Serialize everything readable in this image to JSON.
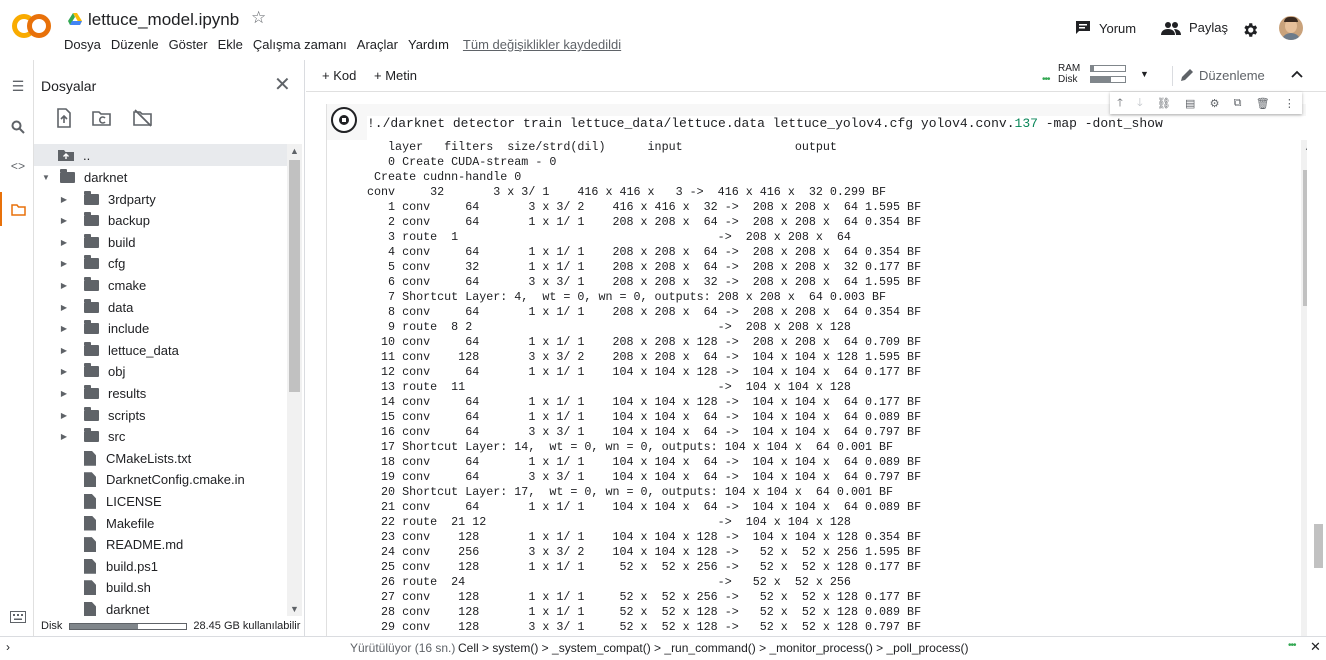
{
  "header": {
    "title": "lettuce_model.ipynb",
    "menu": [
      "Dosya",
      "Düzenle",
      "Göster",
      "Ekle",
      "Çalışma zamanı",
      "Araçlar",
      "Yardım"
    ],
    "saved_label": "Tüm değişiklikler kaydedildi",
    "comment_label": "Yorum",
    "share_label": "Paylaş",
    "logo_text": "CO"
  },
  "files": {
    "title": "Dosyalar",
    "parent_label": "..",
    "root": "darknet",
    "items": [
      {
        "name": "3rdparty",
        "type": "folder"
      },
      {
        "name": "backup",
        "type": "folder"
      },
      {
        "name": "build",
        "type": "folder"
      },
      {
        "name": "cfg",
        "type": "folder"
      },
      {
        "name": "cmake",
        "type": "folder"
      },
      {
        "name": "data",
        "type": "folder"
      },
      {
        "name": "include",
        "type": "folder"
      },
      {
        "name": "lettuce_data",
        "type": "folder"
      },
      {
        "name": "obj",
        "type": "folder"
      },
      {
        "name": "results",
        "type": "folder"
      },
      {
        "name": "scripts",
        "type": "folder"
      },
      {
        "name": "src",
        "type": "folder"
      },
      {
        "name": "CMakeLists.txt",
        "type": "file"
      },
      {
        "name": "DarknetConfig.cmake.in",
        "type": "file"
      },
      {
        "name": "LICENSE",
        "type": "file"
      },
      {
        "name": "Makefile",
        "type": "file"
      },
      {
        "name": "README.md",
        "type": "file"
      },
      {
        "name": "build.ps1",
        "type": "file"
      },
      {
        "name": "build.sh",
        "type": "file"
      },
      {
        "name": "darknet",
        "type": "file"
      }
    ],
    "disk_label": "Disk",
    "disk_usage_fraction": 0.58,
    "disk_text": "28.45 GB kullanılabilir"
  },
  "toolbar": {
    "add_code": "+ Kod",
    "add_text": "+ Metin",
    "ram_label": "RAM",
    "disk_label": "Disk",
    "ram_fraction": 0.1,
    "disk_fraction": 0.6,
    "edit_label": "Düzenleme"
  },
  "cell": {
    "command_prefix": "!./darknet detector train lettuce_data/lettuce.data lettuce_yolov4.cfg yolov4.conv.",
    "command_num": "137",
    "command_suffix": " -map -dont_show",
    "output": [
      "   layer   filters  size/strd(dil)      input                output",
      "   0 Create CUDA-stream - 0",
      " Create cudnn-handle 0",
      "conv     32       3 x 3/ 1    416 x 416 x   3 ->  416 x 416 x  32 0.299 BF",
      "   1 conv     64       3 x 3/ 2    416 x 416 x  32 ->  208 x 208 x  64 1.595 BF",
      "   2 conv     64       1 x 1/ 1    208 x 208 x  64 ->  208 x 208 x  64 0.354 BF",
      "   3 route  1                                     ->  208 x 208 x  64",
      "   4 conv     64       1 x 1/ 1    208 x 208 x  64 ->  208 x 208 x  64 0.354 BF",
      "   5 conv     32       1 x 1/ 1    208 x 208 x  64 ->  208 x 208 x  32 0.177 BF",
      "   6 conv     64       3 x 3/ 1    208 x 208 x  32 ->  208 x 208 x  64 1.595 BF",
      "   7 Shortcut Layer: 4,  wt = 0, wn = 0, outputs: 208 x 208 x  64 0.003 BF",
      "   8 conv     64       1 x 1/ 1    208 x 208 x  64 ->  208 x 208 x  64 0.354 BF",
      "   9 route  8 2                                   ->  208 x 208 x 128",
      "  10 conv     64       1 x 1/ 1    208 x 208 x 128 ->  208 x 208 x  64 0.709 BF",
      "  11 conv    128       3 x 3/ 2    208 x 208 x  64 ->  104 x 104 x 128 1.595 BF",
      "  12 conv     64       1 x 1/ 1    104 x 104 x 128 ->  104 x 104 x  64 0.177 BF",
      "  13 route  11                                    ->  104 x 104 x 128",
      "  14 conv     64       1 x 1/ 1    104 x 104 x 128 ->  104 x 104 x  64 0.177 BF",
      "  15 conv     64       1 x 1/ 1    104 x 104 x  64 ->  104 x 104 x  64 0.089 BF",
      "  16 conv     64       3 x 3/ 1    104 x 104 x  64 ->  104 x 104 x  64 0.797 BF",
      "  17 Shortcut Layer: 14,  wt = 0, wn = 0, outputs: 104 x 104 x  64 0.001 BF",
      "  18 conv     64       1 x 1/ 1    104 x 104 x  64 ->  104 x 104 x  64 0.089 BF",
      "  19 conv     64       3 x 3/ 1    104 x 104 x  64 ->  104 x 104 x  64 0.797 BF",
      "  20 Shortcut Layer: 17,  wt = 0, wn = 0, outputs: 104 x 104 x  64 0.001 BF",
      "  21 conv     64       1 x 1/ 1    104 x 104 x  64 ->  104 x 104 x  64 0.089 BF",
      "  22 route  21 12                                 ->  104 x 104 x 128",
      "  23 conv    128       1 x 1/ 1    104 x 104 x 128 ->  104 x 104 x 128 0.354 BF",
      "  24 conv    256       3 x 3/ 2    104 x 104 x 128 ->   52 x  52 x 256 1.595 BF",
      "  25 conv    128       1 x 1/ 1     52 x  52 x 256 ->   52 x  52 x 128 0.177 BF",
      "  26 route  24                                    ->   52 x  52 x 256",
      "  27 conv    128       1 x 1/ 1     52 x  52 x 256 ->   52 x  52 x 128 0.177 BF",
      "  28 conv    128       1 x 1/ 1     52 x  52 x 128 ->   52 x  52 x 128 0.089 BF",
      "  29 conv    128       3 x 3/ 1     52 x  52 x 128 ->   52 x  52 x 128 0.797 BF"
    ]
  },
  "status": {
    "running": "Yürütülüyor (16 sn.)",
    "trace": "Cell > system() > _system_compat() > _run_command() > _monitor_process() > _poll_process()"
  },
  "colors": {
    "logo_yellow": "#f9ab00",
    "logo_orange": "#e8710a",
    "active_orange": "#e8710a",
    "connected_green": "#34a853",
    "number_green": "#098658"
  }
}
